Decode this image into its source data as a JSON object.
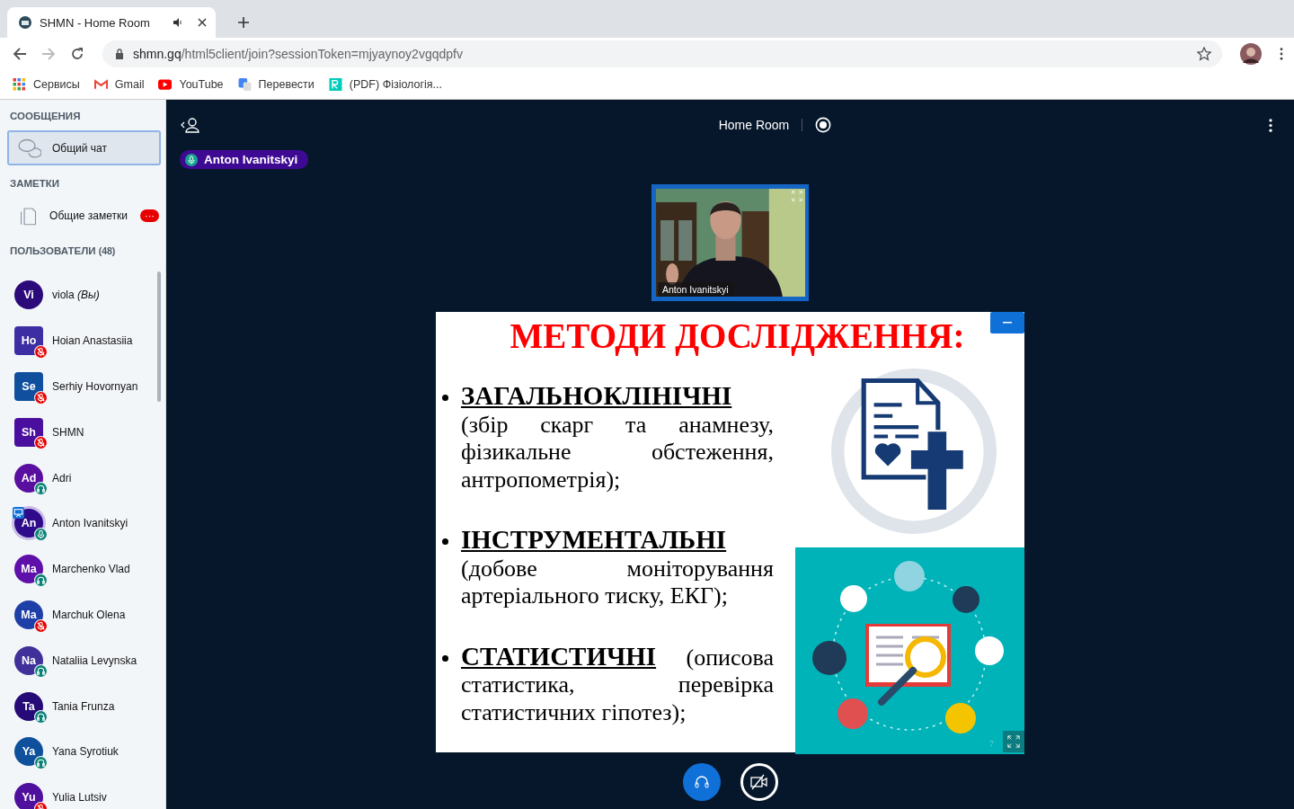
{
  "browser": {
    "tab": {
      "title": "SHMN - Home Room",
      "audio_playing": true
    },
    "url": {
      "host": "shmn.gq",
      "path": "/html5client/join?sessionToken=mjyaynoy2vgqdpfv"
    },
    "bookmarks": [
      {
        "label": "Сервисы",
        "kind": "apps"
      },
      {
        "label": "Gmail",
        "kind": "gmail"
      },
      {
        "label": "YouTube",
        "kind": "youtube"
      },
      {
        "label": "Перевести",
        "kind": "translate"
      },
      {
        "label": "(PDF) Фізіологія...",
        "kind": "rg"
      }
    ]
  },
  "sidebar": {
    "messages": {
      "heading": "СООБЩЕНИЯ",
      "items": [
        {
          "label": "Общий чат",
          "selected": true
        }
      ]
    },
    "notes": {
      "heading": "ЗАМЕТКИ",
      "items": [
        {
          "label": "Общие заметки",
          "badge": "···"
        }
      ]
    },
    "users": {
      "heading": "ПОЛЬЗОВАТЕЛИ",
      "count": "(48)",
      "items": [
        {
          "initials": "Vi",
          "name": "viola *(Вы)*",
          "color": "#2c0a7a",
          "moderator": false,
          "kind": "none",
          "presenter": false
        },
        {
          "initials": "Ho",
          "name": "Hoian Anastasiia",
          "color": "#3d2fa3",
          "moderator": true,
          "kind": "muted",
          "presenter": false
        },
        {
          "initials": "Se",
          "name": "Serhiy Hovornyan",
          "color": "#0f4f9e",
          "moderator": true,
          "kind": "muted",
          "presenter": false
        },
        {
          "initials": "Sh",
          "name": "SHMN",
          "color": "#4a0f9e",
          "moderator": true,
          "kind": "muted",
          "presenter": false
        },
        {
          "initials": "Ad",
          "name": "Adri",
          "color": "#5a0fa0",
          "moderator": false,
          "kind": "listen",
          "presenter": false
        },
        {
          "initials": "An",
          "name": "Anton Ivanitskyi",
          "color": "#2f0a8a",
          "moderator": false,
          "kind": "mic",
          "presenter": true
        },
        {
          "initials": "Ma",
          "name": "Marchenko Vlad",
          "color": "#5e10a8",
          "moderator": false,
          "kind": "listen",
          "presenter": false
        },
        {
          "initials": "Ma",
          "name": "Marchuk Olena",
          "color": "#1f3fa8",
          "moderator": false,
          "kind": "muted",
          "presenter": false
        },
        {
          "initials": "Na",
          "name": "Nataliia Levynska",
          "color": "#40309a",
          "moderator": false,
          "kind": "listen",
          "presenter": false
        },
        {
          "initials": "Ta",
          "name": "Tania Frunza",
          "color": "#250a78",
          "moderator": false,
          "kind": "listen",
          "presenter": false
        },
        {
          "initials": "Ya",
          "name": "Yana Syrotiuk",
          "color": "#0f509c",
          "moderator": false,
          "kind": "listen",
          "presenter": false
        },
        {
          "initials": "Yu",
          "name": "Yulia Lutsiv",
          "color": "#50109e",
          "moderator": false,
          "kind": "muted",
          "presenter": false
        }
      ]
    }
  },
  "meeting": {
    "title": "Home Room",
    "talking": {
      "name": "Anton Ivanitskyi"
    },
    "video": {
      "name": "Anton Ivanitskyi"
    },
    "slide": {
      "title": "МЕТОДИ ДОСЛІДЖЕННЯ:",
      "page": "7",
      "bullets": [
        {
          "term": "ЗАГАЛЬНОКЛІНІЧНІ",
          "text": "(збір скарг та анамнезу, фізикальне обстеження, антропометрія);"
        },
        {
          "term": "ІНСТРУМЕНТАЛЬНІ",
          "text": "(добове моніторування артеріального тиску, ЕКГ);"
        },
        {
          "term": "СТАТИСТИЧНІ",
          "text": "(описова статистика, перевірка статистичних гіпотез);"
        }
      ]
    },
    "controls": {
      "audio_joined": true,
      "camera_on": false
    }
  }
}
